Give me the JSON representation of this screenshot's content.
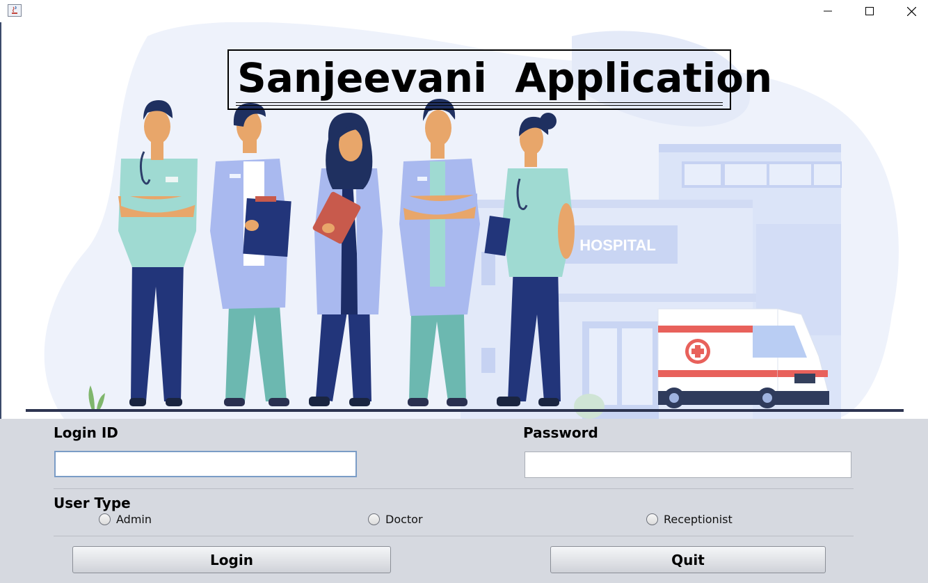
{
  "window": {
    "controls": [
      "minimize",
      "maximize",
      "close"
    ]
  },
  "illustration": {
    "heading": "Sanjeevani  Application",
    "hospital_sign": "HOSPITAL"
  },
  "form": {
    "login_id_label": "Login ID",
    "login_id_value": "",
    "password_label": "Password",
    "password_value": "",
    "user_type_label": "User Type",
    "user_types": [
      {
        "label": "Admin",
        "selected": false
      },
      {
        "label": "Doctor",
        "selected": false
      },
      {
        "label": "Receptionist",
        "selected": false
      }
    ],
    "login_button": "Login",
    "quit_button": "Quit"
  },
  "colors": {
    "form_background": "#d6d9e0",
    "scrub_green": "#9fdad2",
    "navy": "#22357a",
    "coat_lavender": "#a9b9ef",
    "hospital_blue": "#cdd8f5",
    "ambulance_red": "#e8615b"
  },
  "icons": [
    "java-app-icon",
    "minimize-icon",
    "maximize-icon",
    "close-icon"
  ]
}
